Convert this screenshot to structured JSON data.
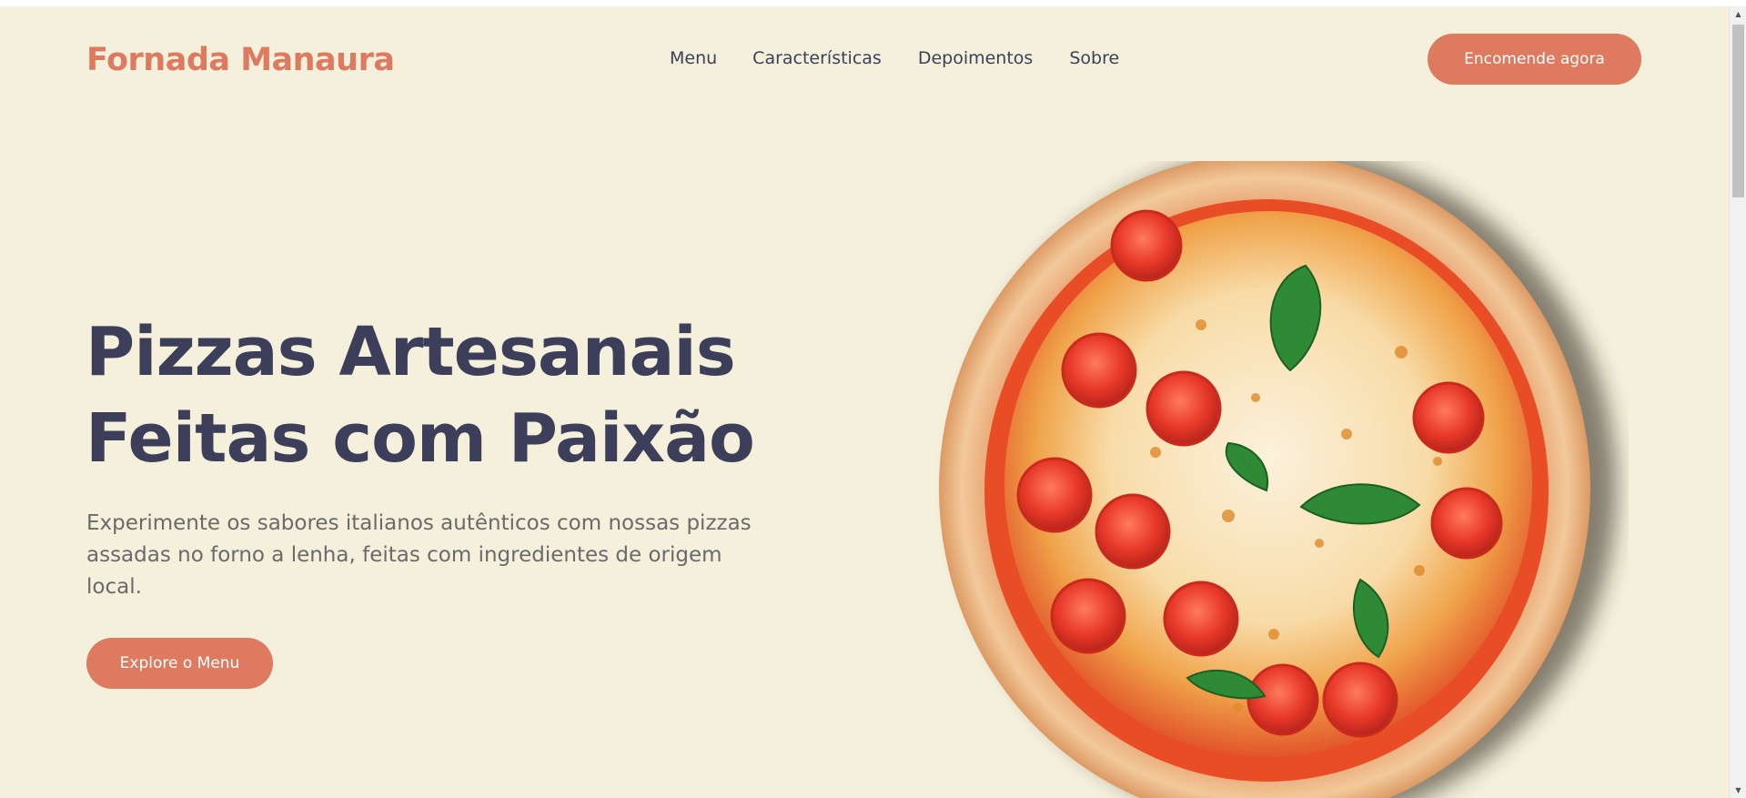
{
  "header": {
    "brand": "Fornada Manaura",
    "nav": [
      "Menu",
      "Características",
      "Depoimentos",
      "Sobre"
    ],
    "cta": "Encomende agora"
  },
  "hero": {
    "title_line1": "Pizzas Artesanais",
    "title_line2": "Feitas com Paixão",
    "description": "Experimente os sabores italianos autênticos com nossas pizzas assadas no forno a lenha, feitas com ingredientes de origem local.",
    "cta": "Explore o Menu"
  },
  "colors": {
    "background": "#f4f0dc",
    "accent": "#dd7a5f",
    "heading": "#3d3f5a",
    "body_text": "#6a6a6a"
  },
  "icons": {
    "scroll_up": "triangle-up-icon",
    "scroll_down": "triangle-down-icon"
  }
}
